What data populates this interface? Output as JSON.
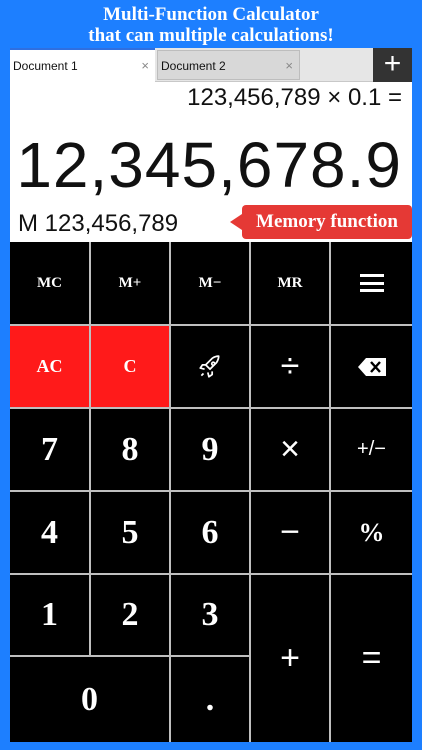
{
  "promo": {
    "line1": "Multi-Function Calculator",
    "line2": "that can multiple calculations!"
  },
  "tabs": [
    {
      "label": "Document 1",
      "close": "×"
    },
    {
      "label": "Document 2",
      "close": "×"
    }
  ],
  "add_tab": "+",
  "expression": "123,456,789 × 0.1 =",
  "display": "12,345,678.9",
  "memory": "M 123,456,789",
  "callout": "Memory function",
  "keys": {
    "mc": "MC",
    "mplus": "M+",
    "mminus": "M−",
    "mr": "MR",
    "ac": "AC",
    "c": "C",
    "divide": "÷",
    "seven": "7",
    "eight": "8",
    "nine": "9",
    "multiply": "×",
    "plusminus": "+/−",
    "four": "4",
    "five": "5",
    "six": "6",
    "minus": "−",
    "percent": "%",
    "one": "1",
    "two": "2",
    "three": "3",
    "plus": "+",
    "equals": "=",
    "zero": "0",
    "decimal": "."
  },
  "icons": {
    "menu": "hamburger-icon",
    "backspace": "backspace-icon",
    "rocket": "rocket-icon"
  },
  "colors": {
    "background": "#1d7fff",
    "key": "#000000",
    "clear_key": "#ff1a1a",
    "callout": "#e53935"
  }
}
